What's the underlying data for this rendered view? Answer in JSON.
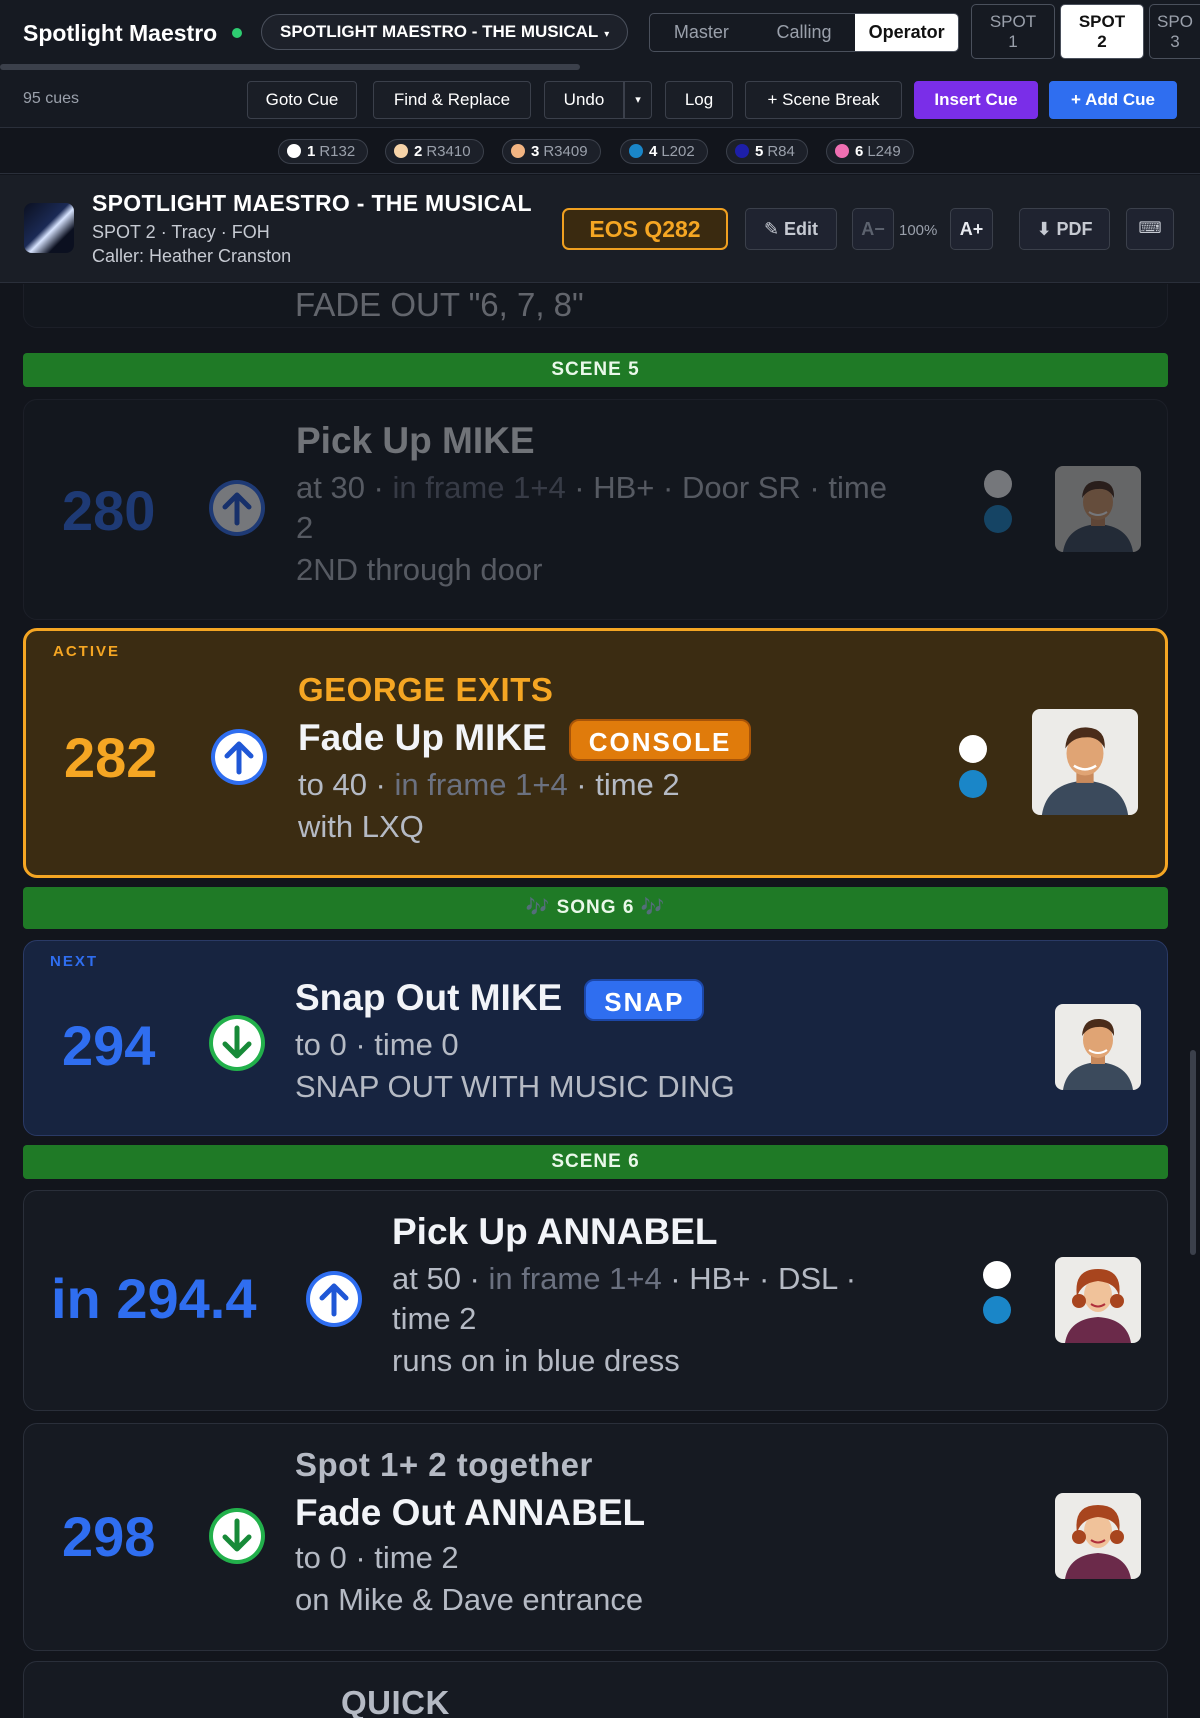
{
  "header": {
    "app_title": "Spotlight Maestro",
    "show_select": "SPOTLIGHT MAESTRO - THE MUSICAL",
    "modes": [
      "Master",
      "Calling",
      "Operator"
    ],
    "active_mode": "Operator",
    "spots": [
      {
        "line1": "SPOT",
        "line2": "1"
      },
      {
        "line1": "SPOT",
        "line2": "2"
      },
      {
        "line1": "SPO",
        "line2": "3"
      }
    ],
    "active_spot": "SPOT 2"
  },
  "toolbar": {
    "cue_count": "95 cues",
    "goto": "Goto Cue",
    "find_replace": "Find & Replace",
    "undo": "Undo",
    "undo_menu": "▾",
    "log": "Log",
    "scene_break": "+ Scene Break",
    "insert_cue": "Insert Cue",
    "add_cue": "+ Add Cue"
  },
  "frames": [
    {
      "num": "1",
      "gel": "R132",
      "color": "#ffffff"
    },
    {
      "num": "2",
      "gel": "R3410",
      "color": "#f6d3a8"
    },
    {
      "num": "3",
      "gel": "R3409",
      "color": "#f2b482"
    },
    {
      "num": "4",
      "gel": "L202",
      "color": "#1a86c8"
    },
    {
      "num": "5",
      "gel": "R84",
      "color": "#1d1fa8"
    },
    {
      "num": "6",
      "gel": "L249",
      "color": "#ef6fb2"
    }
  ],
  "show_info": {
    "title": "SPOTLIGHT MAESTRO - THE MUSICAL",
    "subtitle": "SPOT 2 · Tracy · FOH",
    "caller": "Caller: Heather Cranston",
    "eos_cue": "EOS Q282",
    "edit": "✎ Edit",
    "font_down": "A−",
    "zoom": "100%",
    "font_up": "A+",
    "pdf": "⬇ PDF",
    "keyboard": "⌨"
  },
  "cues": {
    "prev_tail": "FADE OUT \"6, 7, 8\"",
    "scene5": "SCENE 5",
    "c280": {
      "num": "280",
      "action": "Pick Up MIKE",
      "d1": "at 30 · ",
      "d1_faint": "in frame 1+4",
      "d1b": " · HB+ · Door SR · time",
      "d2": "2",
      "note": "2ND through door"
    },
    "c282": {
      "status": "ACTIVE",
      "num": "282",
      "lead": "GEORGE EXITS",
      "action": "Fade Up MIKE",
      "pill": "CONSOLE",
      "d1": "to 40 · ",
      "d1_faint": "in frame 1+4",
      "d1b": " · time 2",
      "note": "with LXQ"
    },
    "song6": "🎶  SONG 6  🎶",
    "c294": {
      "status": "NEXT",
      "num": "294",
      "action": "Snap Out MIKE",
      "pill": "SNAP",
      "d1": "to 0 · time 0",
      "note": "SNAP OUT WITH MUSIC DING"
    },
    "scene6": "SCENE 6",
    "c294_4": {
      "num": "in 294.4",
      "action": "Pick Up ANNABEL",
      "d1": "at 50 · ",
      "d1_faint": "in frame 1+4",
      "d1b": " · HB+ · DSL ·",
      "d2": "time 2",
      "note": "runs on in blue dress"
    },
    "c298": {
      "num": "298",
      "lead": "Spot 1+ 2 together",
      "action": "Fade Out ANNABEL",
      "d1": "to 0 · time 2",
      "note": "on Mike & Dave entrance"
    },
    "next_tail": "QUICK"
  },
  "colors": {
    "accent_blue": "#2f6ef0",
    "active_orange": "#f5a623",
    "scene_green": "#1f7a26",
    "purple": "#7a2ee8"
  }
}
